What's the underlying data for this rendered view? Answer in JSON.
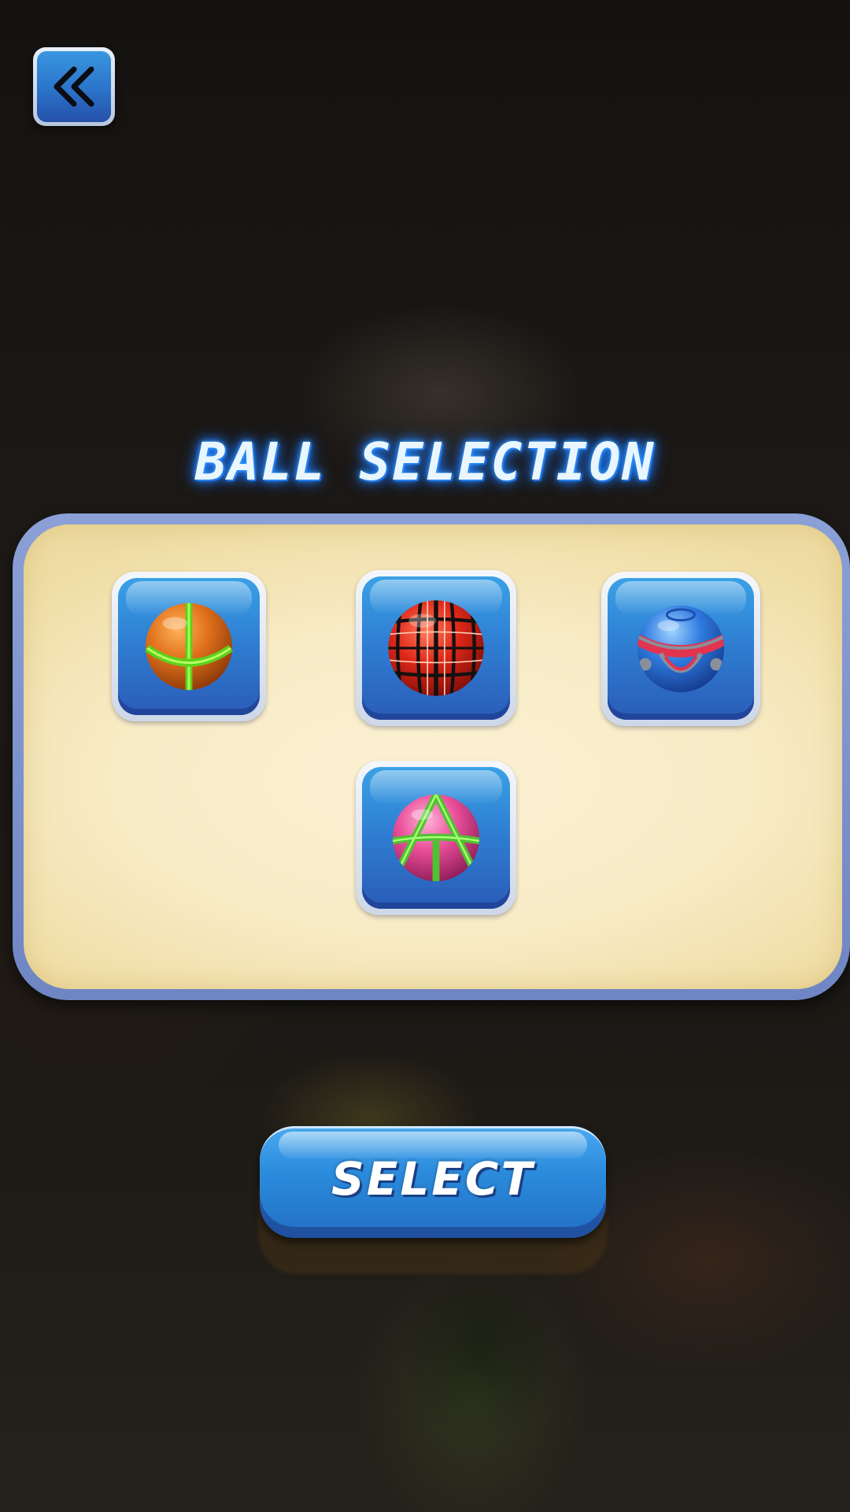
{
  "header": {
    "back_button_icon": "double-chevron-left-icon"
  },
  "title": "BALL SELECTION",
  "balls": [
    {
      "name": "orange-green-ball",
      "base": "#e2721c",
      "stripe": "#7ef023"
    },
    {
      "name": "red-tech-ball",
      "base": "#e0281a",
      "stripe": "#111111"
    },
    {
      "name": "blue-armor-ball",
      "base": "#2f7be0",
      "stripe": "#e2334f"
    },
    {
      "name": "pink-green-ball",
      "base": "#ea4f9a",
      "stripe": "#6fe34a"
    }
  ],
  "select_button": {
    "label": "SELECT"
  },
  "colors": {
    "title_glow": "#1f7fff",
    "button_blue": "#2b8bdc",
    "panel_cream": "#f8ecc6",
    "panel_border": "#7f95cf"
  }
}
